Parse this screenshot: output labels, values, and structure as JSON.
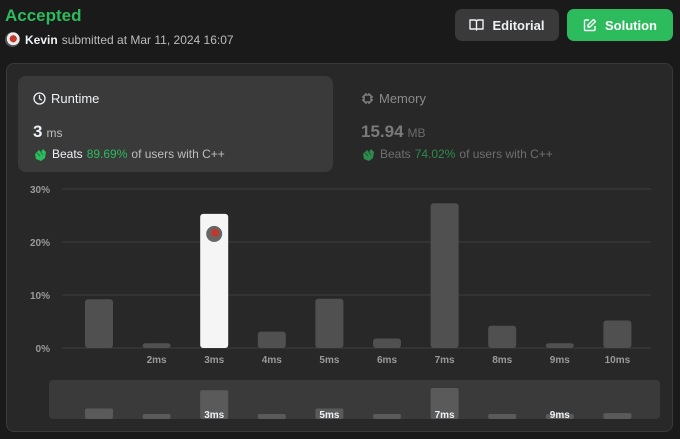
{
  "header": {
    "status": "Accepted",
    "user": "Kevin",
    "submitted": "submitted at Mar 11, 2024 16:07",
    "editorial_label": "Editorial",
    "solution_label": "Solution"
  },
  "runtime": {
    "title": "Runtime",
    "value": "3",
    "unit": "ms",
    "beats_label": "Beats",
    "beats_pct": "89.69%",
    "beats_rest": "of users with C++"
  },
  "memory": {
    "title": "Memory",
    "value": "15.94",
    "unit": "MB",
    "beats_label": "Beats",
    "beats_pct": "74.02%",
    "beats_rest": "of users with C++"
  },
  "colors": {
    "accent": "#2cbb5d",
    "bar": "#505050",
    "highlight": "#f5f5f5"
  },
  "chart_data": {
    "type": "bar",
    "categories": [
      "",
      "2ms",
      "3ms",
      "4ms",
      "5ms",
      "6ms",
      "7ms",
      "8ms",
      "9ms",
      "10ms"
    ],
    "values": [
      9.2,
      0.9,
      25.3,
      3.1,
      9.3,
      1.8,
      27.3,
      4.2,
      0.9,
      5.2
    ],
    "highlight_category": "3ms",
    "yticks": [
      "30%",
      "20%",
      "10%",
      "0%"
    ],
    "ylim": [
      0,
      30
    ],
    "grid": true,
    "navigator_labels": [
      "3ms",
      "5ms",
      "7ms",
      "9ms"
    ]
  }
}
